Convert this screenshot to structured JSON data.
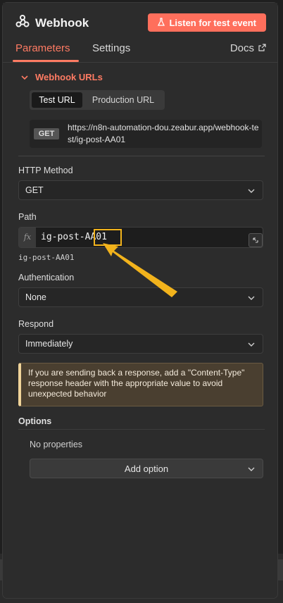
{
  "header": {
    "title": "Webhook",
    "listen_button": "Listen for test event"
  },
  "tabs": [
    {
      "label": "Parameters",
      "active": true
    },
    {
      "label": "Settings",
      "active": false
    }
  ],
  "docs_label": "Docs",
  "webhook_urls": {
    "section_title": "Webhook URLs",
    "toggle": [
      {
        "label": "Test URL",
        "selected": true
      },
      {
        "label": "Production URL",
        "selected": false
      }
    ],
    "method_badge": "GET",
    "url": "https://n8n-automation-dou.zeabur.app/webhook-test/ig-post-AA01"
  },
  "http_method": {
    "label": "HTTP Method",
    "value": "GET"
  },
  "path": {
    "label": "Path",
    "fx_label": "fx",
    "value": "ig-post-AA01",
    "preview": "ig-post-AA01"
  },
  "authentication": {
    "label": "Authentication",
    "value": "None"
  },
  "respond": {
    "label": "Respond",
    "value": "Immediately"
  },
  "notice": "If you are sending back a response, add a \"Content-Type\" response header with the appropriate value to avoid unexpected behavior",
  "options": {
    "label": "Options",
    "empty_text": "No properties",
    "add_button": "Add option"
  },
  "colors": {
    "accent": "#ff7b63",
    "listen_button_bg": "#ff6f5c",
    "highlight": "#f2b31c",
    "panel_bg": "#2c2c2c"
  }
}
